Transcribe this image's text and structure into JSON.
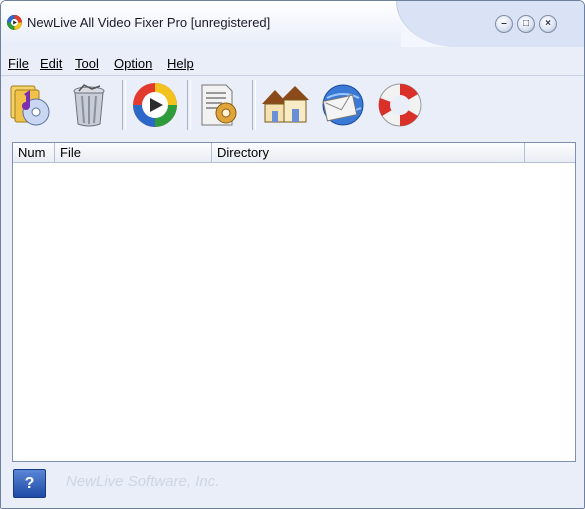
{
  "window": {
    "title": "NewLive All Video Fixer Pro  [unregistered]",
    "buttons": {
      "minimize": "–",
      "maximize": "□",
      "close": "×"
    }
  },
  "menu": [
    {
      "label": "File",
      "accel": "F"
    },
    {
      "label": "Edit",
      "accel": "E"
    },
    {
      "label": "Tool",
      "accel": "T"
    },
    {
      "label": "Option",
      "accel": "O"
    },
    {
      "label": "Help",
      "accel": "H"
    }
  ],
  "toolbar": {
    "icons": [
      "add-files-icon",
      "recycle-bin-icon",
      "play-video-icon",
      "settings-document-icon",
      "homepage-houses-icon",
      "email-globe-icon",
      "help-lifebuoy-icon"
    ]
  },
  "list": {
    "columns": [
      "Num",
      "File",
      "Directory"
    ],
    "rows": []
  },
  "status": {
    "brand": "NewLive Software, Inc."
  },
  "colors": {
    "window_bg": "#e9eef9",
    "border": "#6f7f9c",
    "brand_text": "#cfd6e3"
  }
}
